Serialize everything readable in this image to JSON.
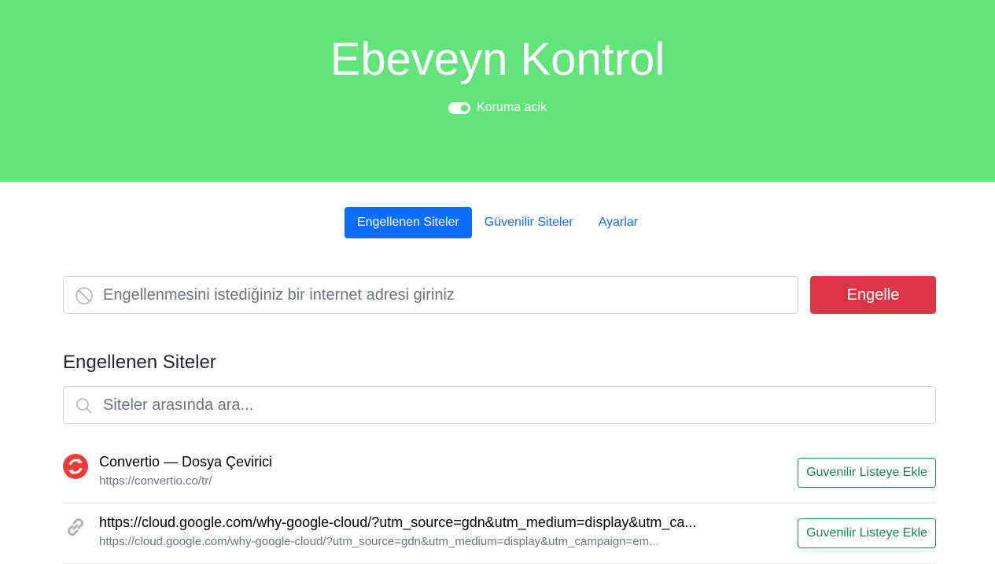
{
  "header": {
    "title": "Ebeveyn Kontrol",
    "protection_label": "Koruma acik",
    "protection_on": true,
    "background_color": "#62e47b"
  },
  "tabs": [
    {
      "label": "Engellenen Siteler",
      "active": true
    },
    {
      "label": "Güvenilir Siteler",
      "active": false
    },
    {
      "label": "Ayarlar",
      "active": false
    }
  ],
  "block_form": {
    "input_icon": "ban-icon",
    "placeholder": "Engellenmesini istediğiniz bir internet adresi giriniz",
    "value": "",
    "button_label": "Engelle",
    "button_color": "#dc3545"
  },
  "blocked_section": {
    "title": "Engellenen Siteler",
    "search_icon": "search-icon",
    "search_placeholder": "Siteler arasında ara...",
    "search_value": ""
  },
  "sites": [
    {
      "icon": "convertio-icon",
      "title": "Convertio — Dosya Çevirici",
      "url": "https://convertio.co/tr/",
      "action_label": "Guvenilir Listeye Ekle"
    },
    {
      "icon": "link-icon",
      "title": "https://cloud.google.com/why-google-cloud/?utm_source=gdn&utm_medium=display&utm_ca...",
      "url": "https://cloud.google.com/why-google-cloud/?utm_source=gdn&utm_medium=display&utm_campaign=em...",
      "action_label": "Guvenilir Listeye Ekle"
    }
  ]
}
